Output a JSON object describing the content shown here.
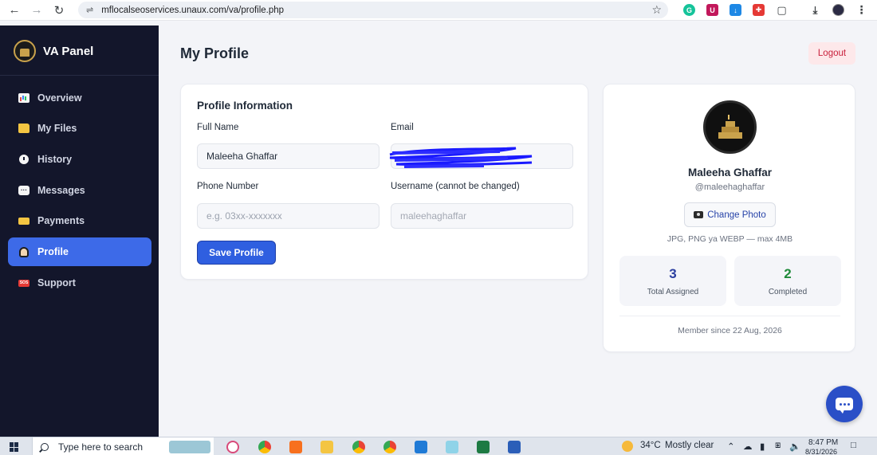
{
  "browser": {
    "url": "mflocalseoservices.unaux.com/va/profile.php"
  },
  "sidebar": {
    "brand": "VA Panel",
    "items": [
      {
        "label": "Overview",
        "icon": "chart-icon"
      },
      {
        "label": "My Files",
        "icon": "folder-icon"
      },
      {
        "label": "History",
        "icon": "clock-icon"
      },
      {
        "label": "Messages",
        "icon": "message-icon"
      },
      {
        "label": "Payments",
        "icon": "card-icon"
      },
      {
        "label": "Profile",
        "icon": "user-icon",
        "active": true
      },
      {
        "label": "Support",
        "icon": "sos-icon"
      }
    ]
  },
  "header": {
    "title": "My Profile",
    "logout_label": "Logout"
  },
  "form": {
    "title": "Profile Information",
    "full_name_label": "Full Name",
    "full_name_value": "Maleeha Ghaffar",
    "email_label": "Email",
    "email_value": "",
    "phone_label": "Phone Number",
    "phone_placeholder": "e.g. 03xx-xxxxxxx",
    "username_label": "Username (cannot be changed)",
    "username_value": "maleehaghaffar",
    "save_label": "Save Profile"
  },
  "profile_card": {
    "name": "Maleeha Ghaffar",
    "username": "@maleehaghaffar",
    "change_photo_label": "Change Photo",
    "photo_hint": "JPG, PNG ya WEBP — max 4MB",
    "stats": [
      {
        "value": "3",
        "label": "Total Assigned",
        "color": "#2b3fa0"
      },
      {
        "value": "2",
        "label": "Completed",
        "color": "#1f8a3a"
      }
    ],
    "member_since": "Member since 22 Aug, 2026"
  },
  "taskbar": {
    "search_placeholder": "Type here to search",
    "weather_temp": "34°C",
    "weather_desc": "Mostly clear",
    "time": "8:47 PM",
    "date": "8/31/2026"
  },
  "colors": {
    "sidebar_bg": "#13162b",
    "accent": "#3d6ae8",
    "save_button": "#2f5fe0",
    "logout_text": "#c81e3a"
  }
}
